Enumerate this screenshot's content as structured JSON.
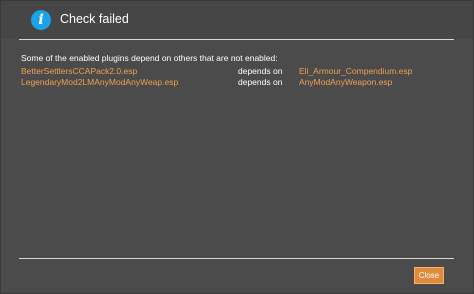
{
  "dialog": {
    "title": "Check failed",
    "icon": "info-icon",
    "message": "Some of the enabled plugins depend on others that are not enabled:",
    "dependencies": [
      {
        "plugin": "BetterSettlersCCAPack2.0.esp",
        "relation": "depends on",
        "requires": "Eli_Armour_Compendium.esp"
      },
      {
        "plugin": "LegendaryMod2LMAnyModAnyWeap.esp",
        "relation": "depends on",
        "requires": "AnyModAnyWeapon.esp"
      }
    ],
    "close_label": "Close"
  },
  "colors": {
    "background": "#4b4b4b",
    "accent": "#e08a3c",
    "info": "#1aa3e6",
    "link_text": "#f0a050"
  }
}
